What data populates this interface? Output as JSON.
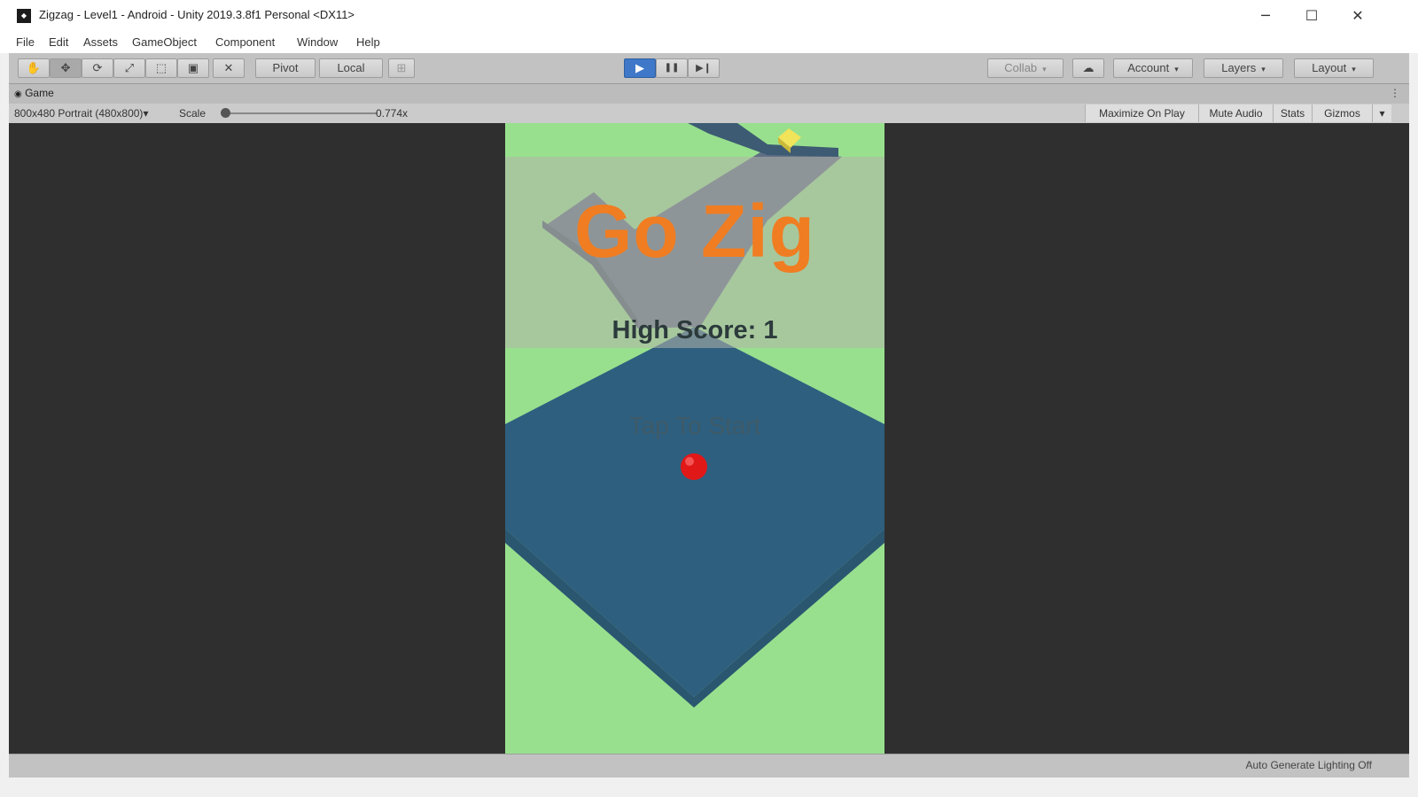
{
  "window": {
    "title": "Zigzag - Level1 - Android - Unity 2019.3.8f1 Personal <DX11>",
    "app_icon": "unity-icon",
    "controls": {
      "minimize": "─",
      "maximize": "☐",
      "close": "✕"
    }
  },
  "menubar": {
    "items": [
      "File",
      "Edit",
      "Assets",
      "GameObject",
      "Component",
      "Window",
      "Help"
    ]
  },
  "toolbar": {
    "tools": [
      {
        "name": "hand-tool-icon",
        "glyph": "✋"
      },
      {
        "name": "move-tool-icon",
        "glyph": "✥"
      },
      {
        "name": "rotate-tool-icon",
        "glyph": "⟳"
      },
      {
        "name": "scale-tool-icon",
        "glyph": "⤢"
      },
      {
        "name": "rect-tool-icon",
        "glyph": "⬚"
      },
      {
        "name": "transform-tool-icon",
        "glyph": "▣"
      },
      {
        "name": "custom-tool-icon",
        "glyph": "✕"
      }
    ],
    "pivot_label": "Pivot",
    "local_label": "Local",
    "snap_glyph": "⊞",
    "play_glyph": "▶",
    "pause_glyph": "❚❚",
    "step_glyph": "▶❙",
    "collab_label": "Collab",
    "cloud_glyph": "☁",
    "account_label": "Account",
    "layers_label": "Layers",
    "layout_label": "Layout",
    "dropdown_glyph": "▾"
  },
  "game_tab": {
    "label": "Game",
    "icon_glyph": "👾",
    "menu_glyph": "⋮"
  },
  "game_view_bar": {
    "resolution": "800x480 Portrait (480x800)",
    "scale_label": "Scale",
    "scale_value": "0.774x",
    "scale_fraction": 0.0,
    "maximize_on_play": "Maximize On Play",
    "mute_audio": "Mute Audio",
    "stats": "Stats",
    "gizmos": "Gizmos"
  },
  "game": {
    "title": "Go Zig",
    "high_score": "High Score: 1",
    "prompt": "Tap To Start",
    "colors": {
      "ground": "#98e08e",
      "platform_top": "#2e5f7f",
      "platform_side": "#254e68",
      "path_top": "#5f6f84",
      "title": "#f07d22",
      "ball": "#e01818",
      "gem": "#f1e35a"
    }
  },
  "statusbar": {
    "lighting": "Auto Generate Lighting Off"
  }
}
